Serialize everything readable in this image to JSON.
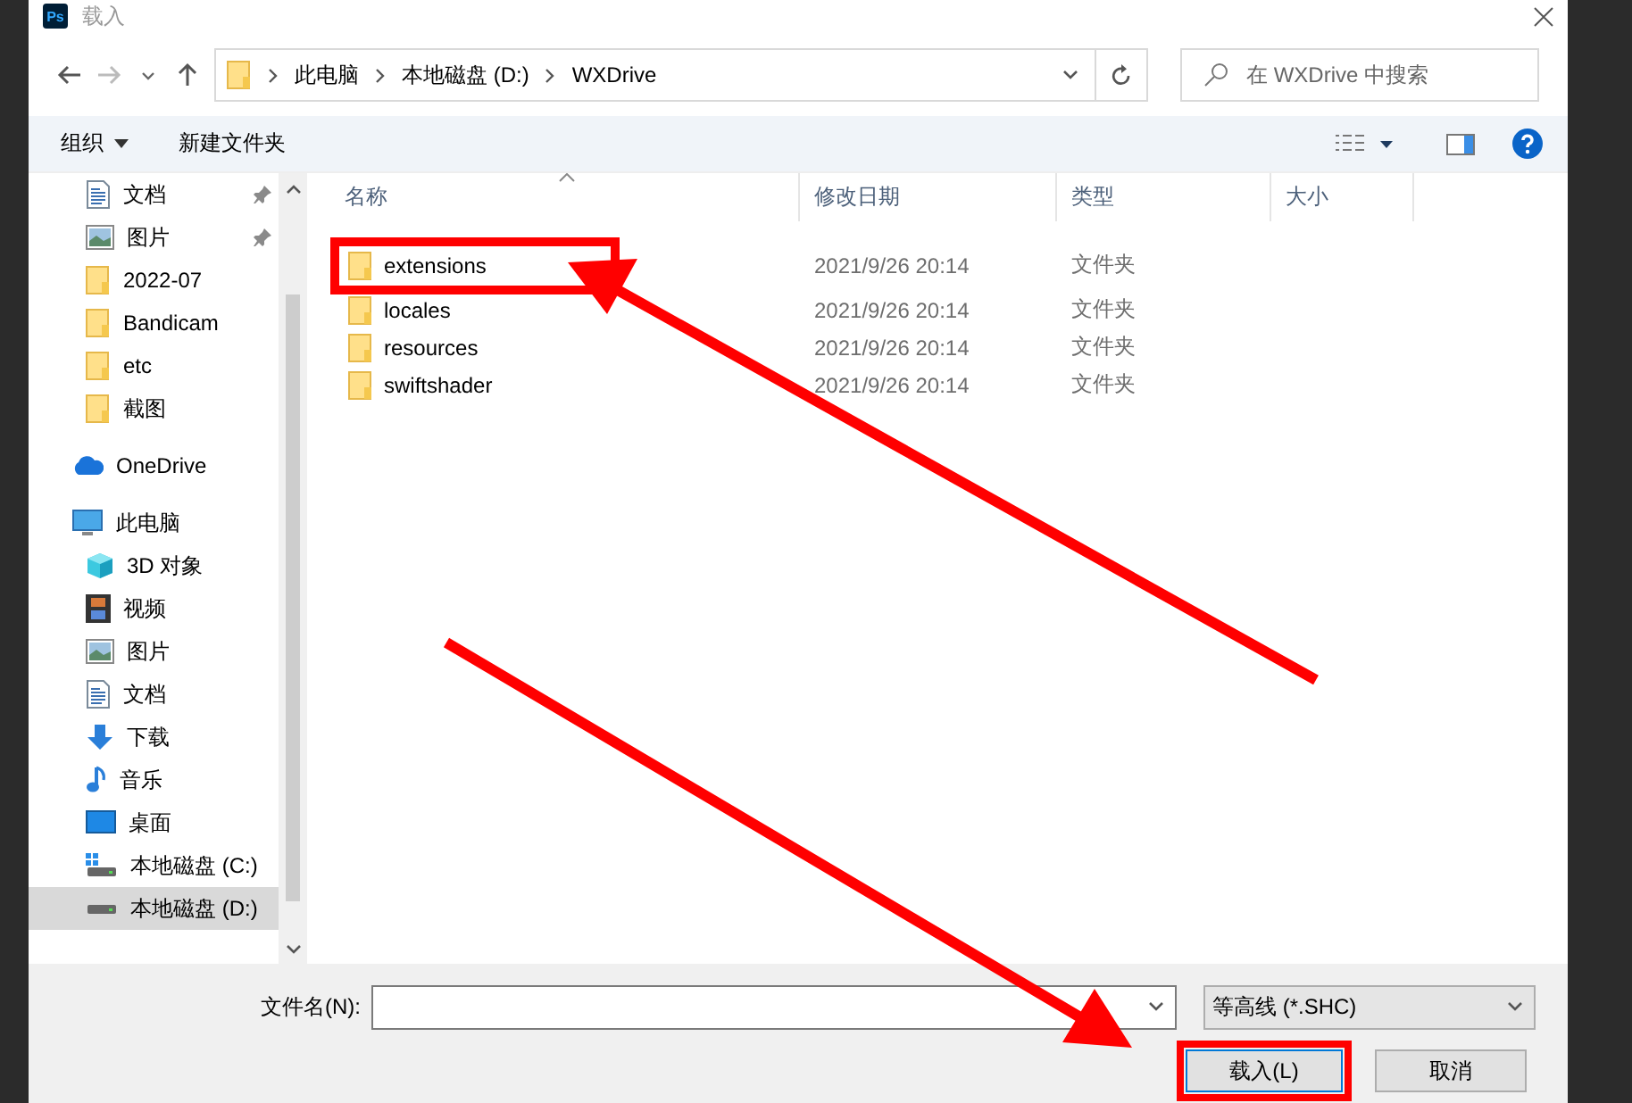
{
  "window": {
    "title": "载入",
    "app_icon_text": "Ps"
  },
  "address": {
    "path": [
      "此电脑",
      "本地磁盘 (D:)",
      "WXDrive"
    ]
  },
  "search": {
    "placeholder": "在 WXDrive 中搜索"
  },
  "toolbar": {
    "organize": "组织",
    "new_folder": "新建文件夹"
  },
  "sidebar": {
    "quick_access_items": [
      {
        "label": "文档",
        "kind": "docs",
        "pinned": true,
        "selected": false
      },
      {
        "label": "图片",
        "kind": "pictures",
        "pinned": true,
        "selected": false
      },
      {
        "label": "2022-07",
        "kind": "folder",
        "pinned": false,
        "selected": false
      },
      {
        "label": "Bandicam",
        "kind": "folder",
        "pinned": false,
        "selected": false
      },
      {
        "label": "etc",
        "kind": "folder",
        "pinned": false,
        "selected": false
      },
      {
        "label": "截图",
        "kind": "folder",
        "pinned": false,
        "selected": false
      }
    ],
    "items": [
      {
        "label": "OneDrive",
        "kind": "cloud",
        "selected": false
      },
      {
        "label": "此电脑",
        "kind": "pc",
        "selected": false,
        "children": [
          {
            "label": "3D 对象",
            "kind": "cube",
            "selected": false
          },
          {
            "label": "视频",
            "kind": "video",
            "selected": false
          },
          {
            "label": "图片",
            "kind": "pictures",
            "selected": false
          },
          {
            "label": "文档",
            "kind": "docs",
            "selected": false
          },
          {
            "label": "下载",
            "kind": "download",
            "selected": false
          },
          {
            "label": "音乐",
            "kind": "music",
            "selected": false
          },
          {
            "label": "桌面",
            "kind": "desktop",
            "selected": false
          },
          {
            "label": "本地磁盘 (C:)",
            "kind": "system_drive",
            "selected": false
          },
          {
            "label": "本地磁盘 (D:)",
            "kind": "drive",
            "selected": true
          }
        ]
      }
    ]
  },
  "table": {
    "columns": [
      {
        "label": "名称",
        "sorted": true
      },
      {
        "label": "修改日期",
        "sorted": false
      },
      {
        "label": "类型",
        "sorted": false
      },
      {
        "label": "大小",
        "sorted": false
      }
    ],
    "rows": [
      {
        "name": "extensions",
        "modified": "2021/9/26 20:14",
        "type": "文件夹",
        "highlighted": true
      },
      {
        "name": "locales",
        "modified": "2021/9/26 20:14",
        "type": "文件夹",
        "highlighted": false
      },
      {
        "name": "resources",
        "modified": "2021/9/26 20:14",
        "type": "文件夹",
        "highlighted": false
      },
      {
        "name": "swiftshader",
        "modified": "2021/9/26 20:14",
        "type": "文件夹",
        "highlighted": false
      }
    ]
  },
  "filename_label": "文件名(N):",
  "file_type": "等高线 (*.SHC)",
  "buttons": [
    {
      "label": "载入(L)",
      "kind": "primary",
      "highlighted": true
    },
    {
      "label": "取消",
      "kind": "secondary",
      "highlighted": false
    }
  ]
}
